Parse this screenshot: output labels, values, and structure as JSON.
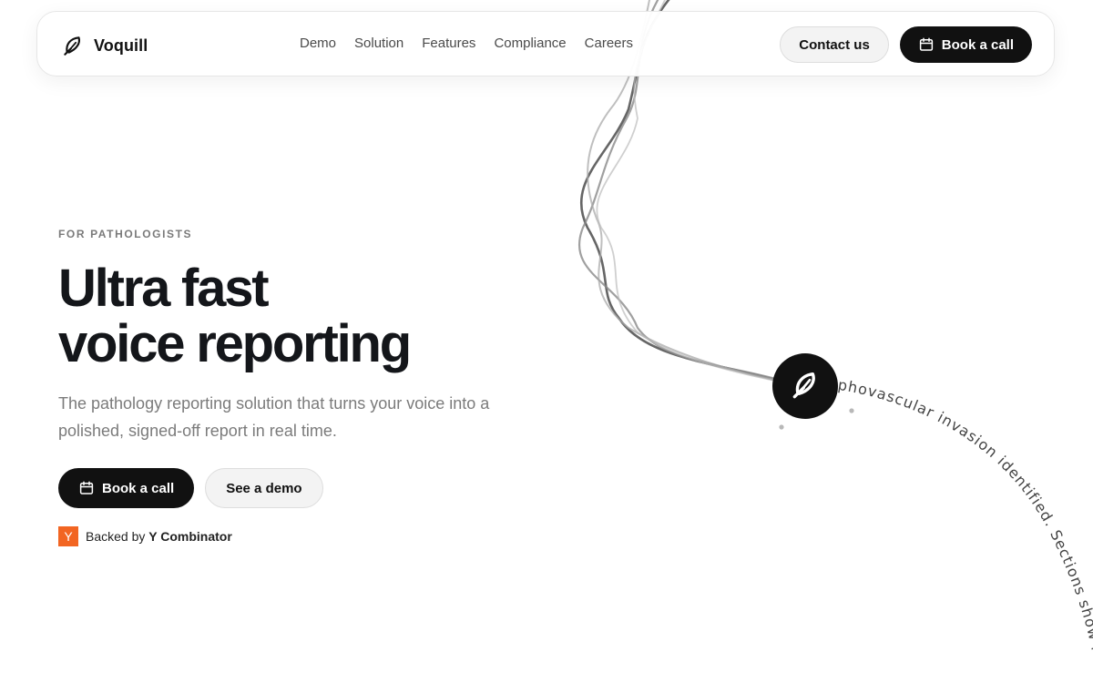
{
  "brand": {
    "name": "Voquill",
    "icon": "feather-pen-icon"
  },
  "nav": {
    "links": [
      "Demo",
      "Solution",
      "Features",
      "Compliance",
      "Careers"
    ],
    "contact_label": "Contact us",
    "book_label": "Book a call"
  },
  "hero": {
    "eyebrow": "FOR PATHOLOGISTS",
    "headline_line1": "Ultra fast",
    "headline_line2": "voice reporting",
    "subtitle": "The pathology reporting solution that turns your voice into a polished, signed-off report in real time.",
    "book_label": "Book a call",
    "demo_label": "See a demo",
    "backed_prefix": "Backed by",
    "backed_by": "Y Combinator",
    "yc_badge": "Y"
  },
  "art": {
    "transcript_text": "Lymphovascular invasion identified. Sections show invasive"
  },
  "colors": {
    "accent": "#111111",
    "yc_orange": "#f26522",
    "muted": "#7b7b7b"
  }
}
